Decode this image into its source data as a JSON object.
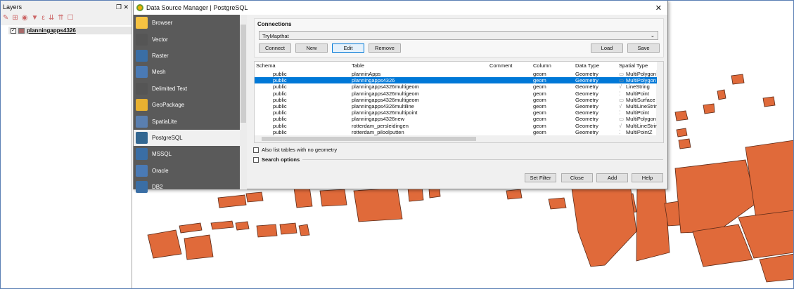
{
  "layers_panel": {
    "title": "Layers",
    "layer": {
      "name": "planningapps4326",
      "checked": true
    }
  },
  "dialog": {
    "title": "Data Source Manager | PostgreSQL",
    "sidebar": [
      {
        "label": "Browser",
        "icon": "folder-icon",
        "color": "#f5c242"
      },
      {
        "label": "Vector",
        "icon": "vector-icon",
        "color": "#555"
      },
      {
        "label": "Raster",
        "icon": "raster-icon",
        "color": "#3a6ea5"
      },
      {
        "label": "Mesh",
        "icon": "mesh-icon",
        "color": "#4a7ab5"
      },
      {
        "label": "Delimited Text",
        "icon": "delimited-text-icon",
        "color": "#555"
      },
      {
        "label": "GeoPackage",
        "icon": "geopackage-icon",
        "color": "#e8b130"
      },
      {
        "label": "SpatiaLite",
        "icon": "spatialite-icon",
        "color": "#5a7fb0"
      },
      {
        "label": "PostgreSQL",
        "icon": "postgresql-icon",
        "color": "#336791",
        "selected": true
      },
      {
        "label": "MSSQL",
        "icon": "mssql-icon",
        "color": "#3a6ea5"
      },
      {
        "label": "Oracle",
        "icon": "oracle-icon",
        "color": "#4a7ab5"
      },
      {
        "label": "DB2",
        "icon": "db2-icon",
        "color": "#3a6ea5"
      }
    ],
    "connections": {
      "label": "Connections",
      "selected": "TryMapthat",
      "buttons": [
        "Connect",
        "New",
        "Edit",
        "Remove",
        "Load",
        "Save"
      ]
    },
    "table": {
      "columns": [
        "Schema",
        "Table",
        "Comment",
        "Column",
        "Data Type",
        "Spatial Type"
      ],
      "rows": [
        [
          "public",
          "planninApps",
          "",
          "geom",
          "Geometry",
          "MultiPolygon"
        ],
        [
          "public",
          "planningapps4326",
          "",
          "geom",
          "Geometry",
          "MultiPolygon"
        ],
        [
          "public",
          "planningapps4326multigeom",
          "",
          "geom",
          "Geometry",
          "LineString"
        ],
        [
          "public",
          "planningapps4326multigeom",
          "",
          "geom",
          "Geometry",
          "MultiPoint"
        ],
        [
          "public",
          "planningapps4326multigeom",
          "",
          "geom",
          "Geometry",
          "MultiSurface"
        ],
        [
          "public",
          "planningapps4326multiline",
          "",
          "geom",
          "Geometry",
          "MultiLineString"
        ],
        [
          "public",
          "planningapps4326multipoint",
          "",
          "geom",
          "Geometry",
          "MultiPoint"
        ],
        [
          "public",
          "planningapps4326new",
          "",
          "geom",
          "Geometry",
          "MultiPolygon"
        ],
        [
          "public",
          "rotterdam_persleidingen",
          "",
          "geom",
          "Geometry",
          "MultiLineString"
        ],
        [
          "public",
          "rotterdam_piloolputten",
          "",
          "geom",
          "Geometry",
          "MultiPointZ"
        ]
      ],
      "selected_row": 1
    },
    "also_list_label": "Also list tables with no geometry",
    "search_options_label": "Search options",
    "footer_buttons": [
      "Set Filter",
      "Close",
      "Add",
      "Help"
    ]
  },
  "map": {
    "fill": "#e06a3a",
    "stroke": "#5a2a18"
  }
}
